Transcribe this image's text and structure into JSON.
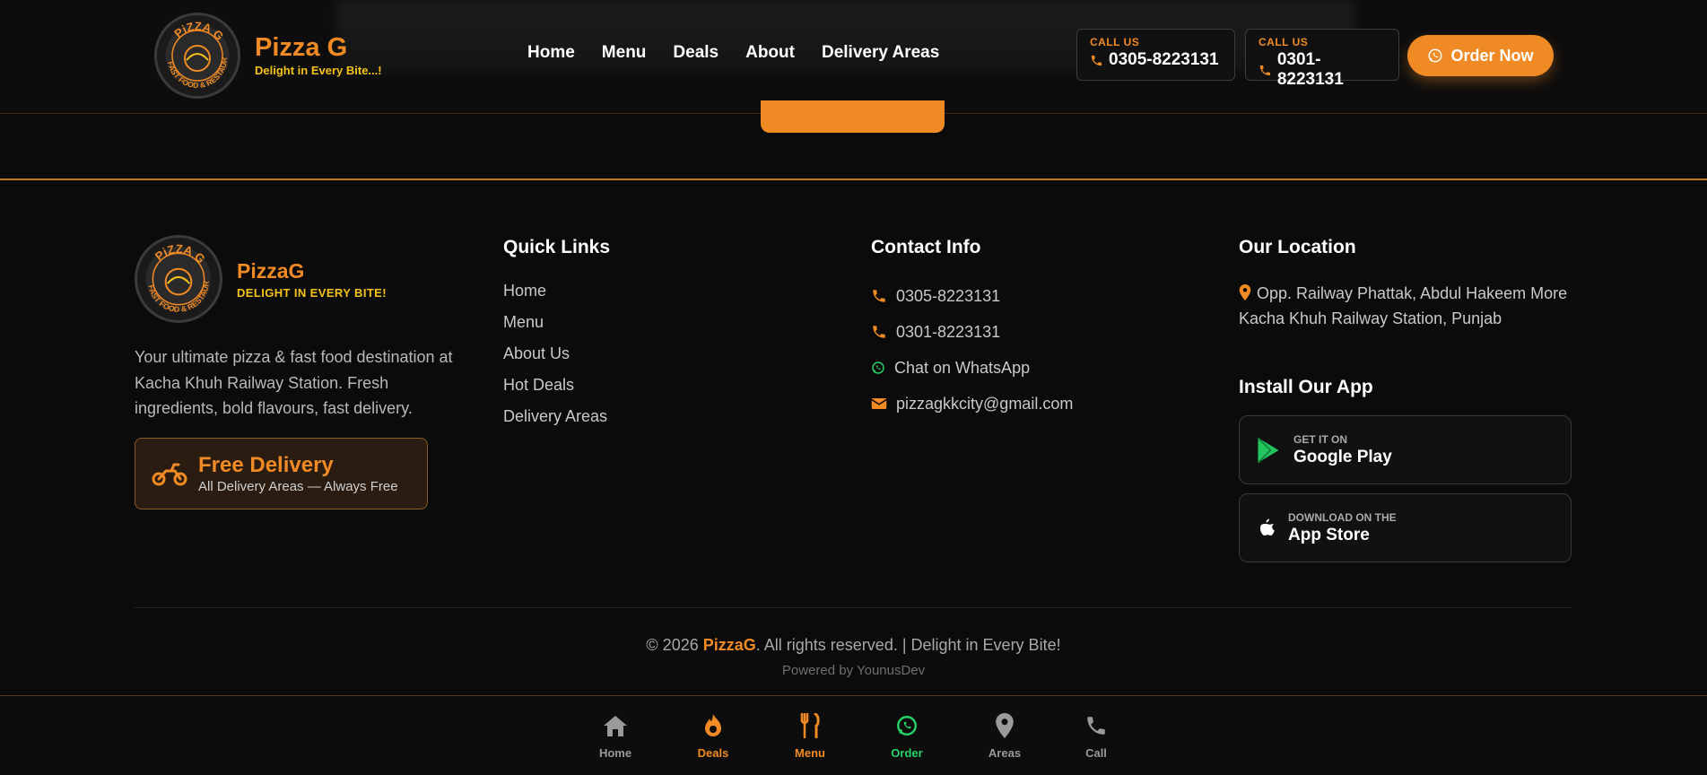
{
  "header": {
    "brand_name": "Pizza G",
    "brand_tagline": "Delight in Every Bite...!",
    "nav": [
      "Home",
      "Menu",
      "Deals",
      "About",
      "Delivery Areas"
    ],
    "calls": [
      {
        "label": "CALL US",
        "number": "0305-8223131"
      },
      {
        "label": "CALL US",
        "number": "0301-8223131"
      }
    ],
    "order_label": "Order Now"
  },
  "logo": {
    "ring_text": "FAST FOOD & RESTAURANT",
    "top_text": "PiZZA G"
  },
  "footer": {
    "brand_name": "PizzaG",
    "brand_tagline": "DELIGHT IN EVERY BITE!",
    "about": "Your ultimate pizza & fast food destination at Kacha Khuh Railway Station. Fresh ingredients, bold flavours, fast delivery.",
    "free_delivery": {
      "title": "Free Delivery",
      "subtitle": "All Delivery Areas — Always Free"
    },
    "quick_links_title": "Quick Links",
    "quick_links": [
      "Home",
      "Menu",
      "About Us",
      "Hot Deals",
      "Delivery Areas"
    ],
    "contact_title": "Contact Info",
    "contact": {
      "phone1": "0305-8223131",
      "phone2": "0301-8223131",
      "whatsapp": "Chat on WhatsApp",
      "email": "pizzagkkcity@gmail.com"
    },
    "location_title": "Our Location",
    "location_line1": "Opp. Railway Phattak, Abdul Hakeem More",
    "location_line2": "Kacha Khuh Railway Station, Punjab",
    "app_title": "Install Our App",
    "google_play": {
      "small": "GET IT ON",
      "big": "Google Play"
    },
    "app_store": {
      "small": "DOWNLOAD ON THE",
      "big": "App Store"
    },
    "copyright_pre": "© 2026 ",
    "copyright_brand": "PizzaG",
    "copyright_post": ". All rights reserved. | Delight in Every Bite!",
    "powered": "Powered by YounusDev"
  },
  "bottom_nav": [
    {
      "label": "Home",
      "icon": "home-icon",
      "color": "#9a9a9a"
    },
    {
      "label": "Deals",
      "icon": "fire-icon",
      "color": "#f08a24"
    },
    {
      "label": "Menu",
      "icon": "utensils-icon",
      "color": "#f08a24",
      "active": true
    },
    {
      "label": "Order",
      "icon": "whatsapp-icon",
      "color": "#25d366"
    },
    {
      "label": "Areas",
      "icon": "map-pin-icon",
      "color": "#9a9a9a"
    },
    {
      "label": "Call",
      "icon": "phone-icon",
      "color": "#9a9a9a"
    }
  ],
  "colors": {
    "accent": "#f08a24",
    "yellow": "#f5c21b",
    "whatsapp": "#25d366",
    "background": "#0b0b0b"
  }
}
